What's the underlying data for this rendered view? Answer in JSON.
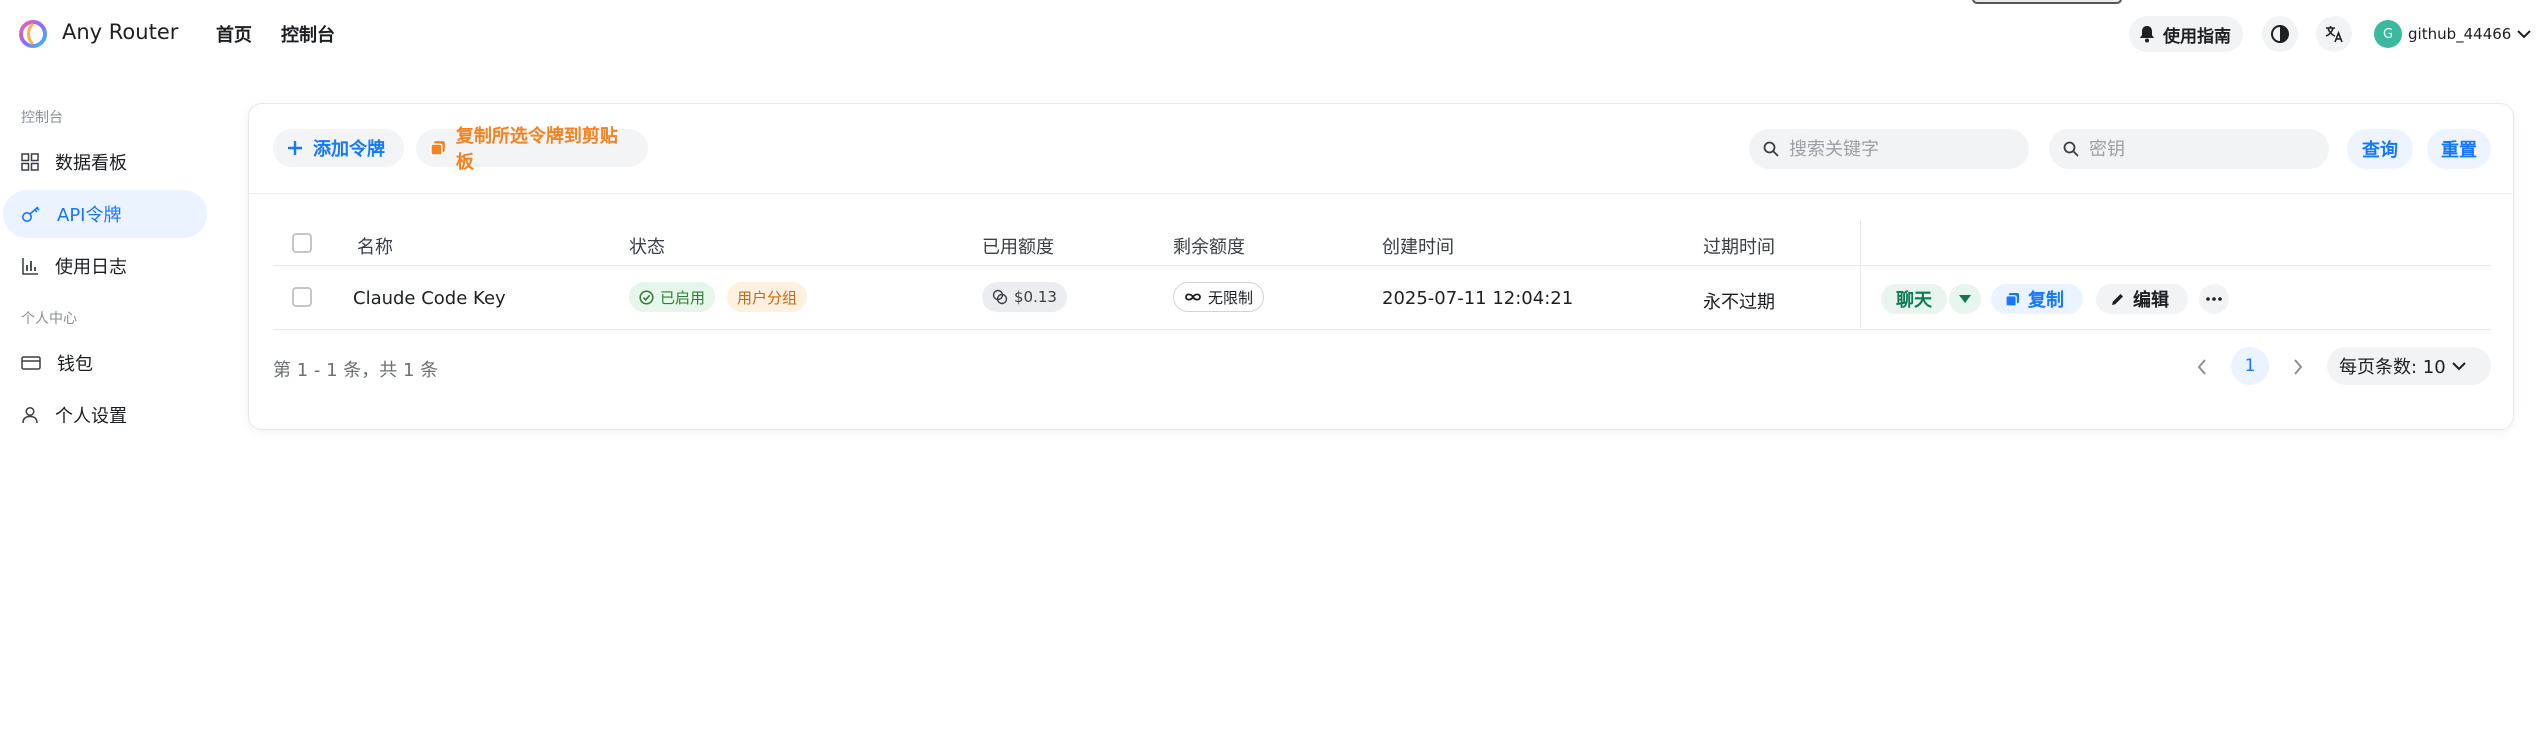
{
  "app": {
    "brand": "Any Router"
  },
  "nav": {
    "home": "首页",
    "console": "控制台"
  },
  "header": {
    "guide_label": "使用指南",
    "user_initial": "G",
    "username": "github_44466"
  },
  "sidebar": {
    "group_console": "控制台",
    "group_personal": "个人中心",
    "items": [
      {
        "label": "数据看板",
        "icon": "dashboard-icon"
      },
      {
        "label": "API令牌",
        "icon": "key-icon",
        "active": true
      },
      {
        "label": "使用日志",
        "icon": "bar-chart-icon"
      },
      {
        "label": "钱包",
        "icon": "wallet-icon"
      },
      {
        "label": "个人设置",
        "icon": "user-icon"
      }
    ]
  },
  "toolbar": {
    "add_label": "添加令牌",
    "copy_selected_label": "复制所选令牌到剪贴板",
    "search_placeholder": "搜索关键字",
    "key_placeholder": "密钥",
    "query_label": "查询",
    "reset_label": "重置"
  },
  "table": {
    "columns": {
      "name": "名称",
      "status": "状态",
      "used": "已用额度",
      "remaining": "剩余额度",
      "created": "创建时间",
      "expires": "过期时间"
    },
    "rows": [
      {
        "name": "Claude Code Key",
        "status": "已启用",
        "group": "用户分组",
        "used": "$0.13",
        "remaining": "无限制",
        "created": "2025-07-11 12:04:21",
        "expires": "永不过期",
        "actions": {
          "chat": "聊天",
          "copy": "复制",
          "edit": "编辑"
        }
      }
    ]
  },
  "pagination": {
    "info": "第 1 - 1 条，共 1 条",
    "current": "1",
    "size_label": "每页条数: 10"
  },
  "colors": {
    "accent": "#1677ff",
    "copy_orange": "#f5821f",
    "active_bg": "#eaf3ff",
    "enabled_green": "#2e7d32"
  }
}
